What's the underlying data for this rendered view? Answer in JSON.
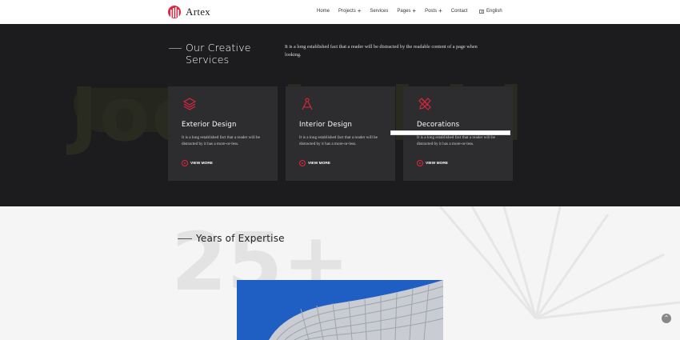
{
  "brand": {
    "name": "Artex"
  },
  "nav": {
    "items": [
      {
        "label": "Home",
        "has_submenu": false
      },
      {
        "label": "Projects",
        "has_submenu": true
      },
      {
        "label": "Services",
        "has_submenu": false
      },
      {
        "label": "Pages",
        "has_submenu": true
      },
      {
        "label": "Posts",
        "has_submenu": true
      },
      {
        "label": "Contact",
        "has_submenu": false
      }
    ],
    "submenu_glyph": "+",
    "language": "English"
  },
  "services": {
    "title": "Our Creative Services",
    "description": "It is a long established fact that a reader will be distracted by the readable content of a page when looking.",
    "cards": [
      {
        "icon": "layers-icon",
        "title": "Exterior Design",
        "text": "It is a long established fact that a reader will be distracted by it has a more-or-less.",
        "link": "VIEW MORE"
      },
      {
        "icon": "compass-icon",
        "title": "Interior Design",
        "text": "It is a long established fact that a reader will be distracted by it has a more-or-less.",
        "link": "VIEW MORE"
      },
      {
        "icon": "pencil-ruler-icon",
        "title": "Decorations",
        "text": "It is a long established fact that a reader will be distracted by it has a more-or-less.",
        "link": "VIEW MORE"
      }
    ]
  },
  "watermark": "Joomla.bid",
  "expertise": {
    "title": "Years of Expertise",
    "number": "25+"
  },
  "colors": {
    "accent": "#e0263f",
    "dark_bg": "#1c1c1e",
    "card_bg": "#2d2d2f",
    "light_bg": "#f5f5f5"
  }
}
